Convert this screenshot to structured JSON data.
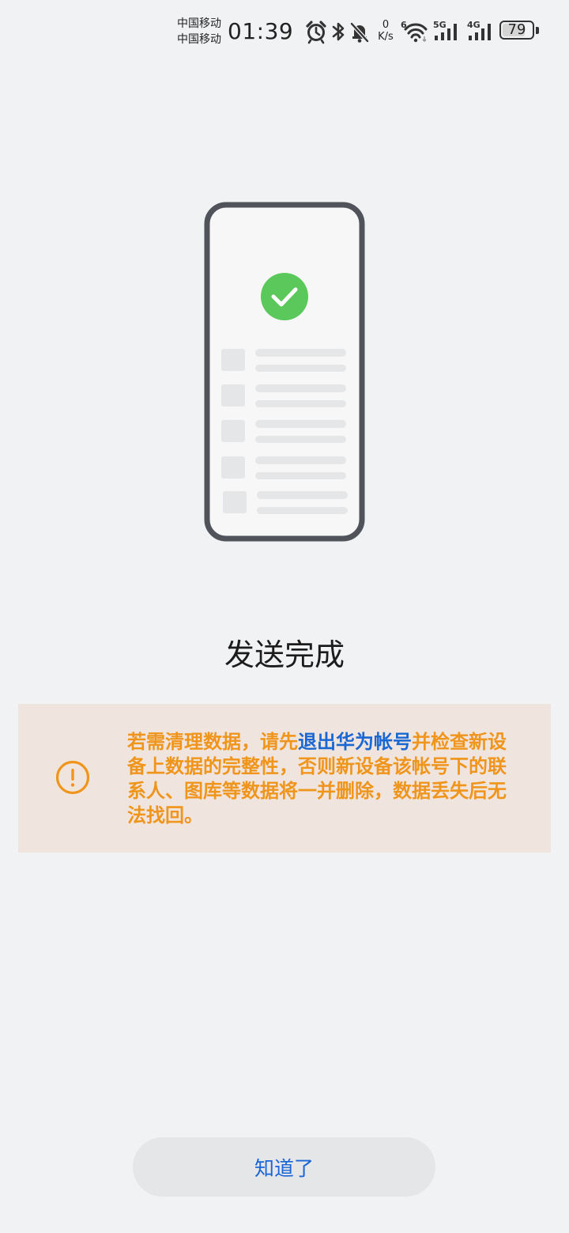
{
  "status_bar": {
    "carrier_1": "中国移动",
    "carrier_2": "中国移动",
    "time": "01:39",
    "net_speed_value": "0",
    "net_speed_unit": "K/s",
    "wifi_label": "6",
    "signal_1_label": "5G",
    "signal_2_label": "4G",
    "battery_level": "79",
    "icons": [
      "alarm-icon",
      "bluetooth-icon",
      "mute-bell-icon",
      "wifi-icon",
      "signal-5g-icon",
      "signal-4g-icon",
      "battery-icon"
    ]
  },
  "illustration": {
    "icons": [
      "phone-icon",
      "check-circle-icon"
    ],
    "accent_color": "#5ac85a"
  },
  "title": "发送完成",
  "warning": {
    "icon": "exclamation-circle-icon",
    "text_before": "若需清理数据，请先",
    "link_text": "退出华为帐号",
    "text_after": "并检查新设备上数据的完整性，否则新设备该帐号下的联系人、图库等数据将一并删除，数据丢失后无法找回。",
    "text_color": "#f0951b",
    "link_color": "#1967d2",
    "background_color": "#f0e4de"
  },
  "button": {
    "label": "知道了",
    "color": "#1765d6"
  }
}
